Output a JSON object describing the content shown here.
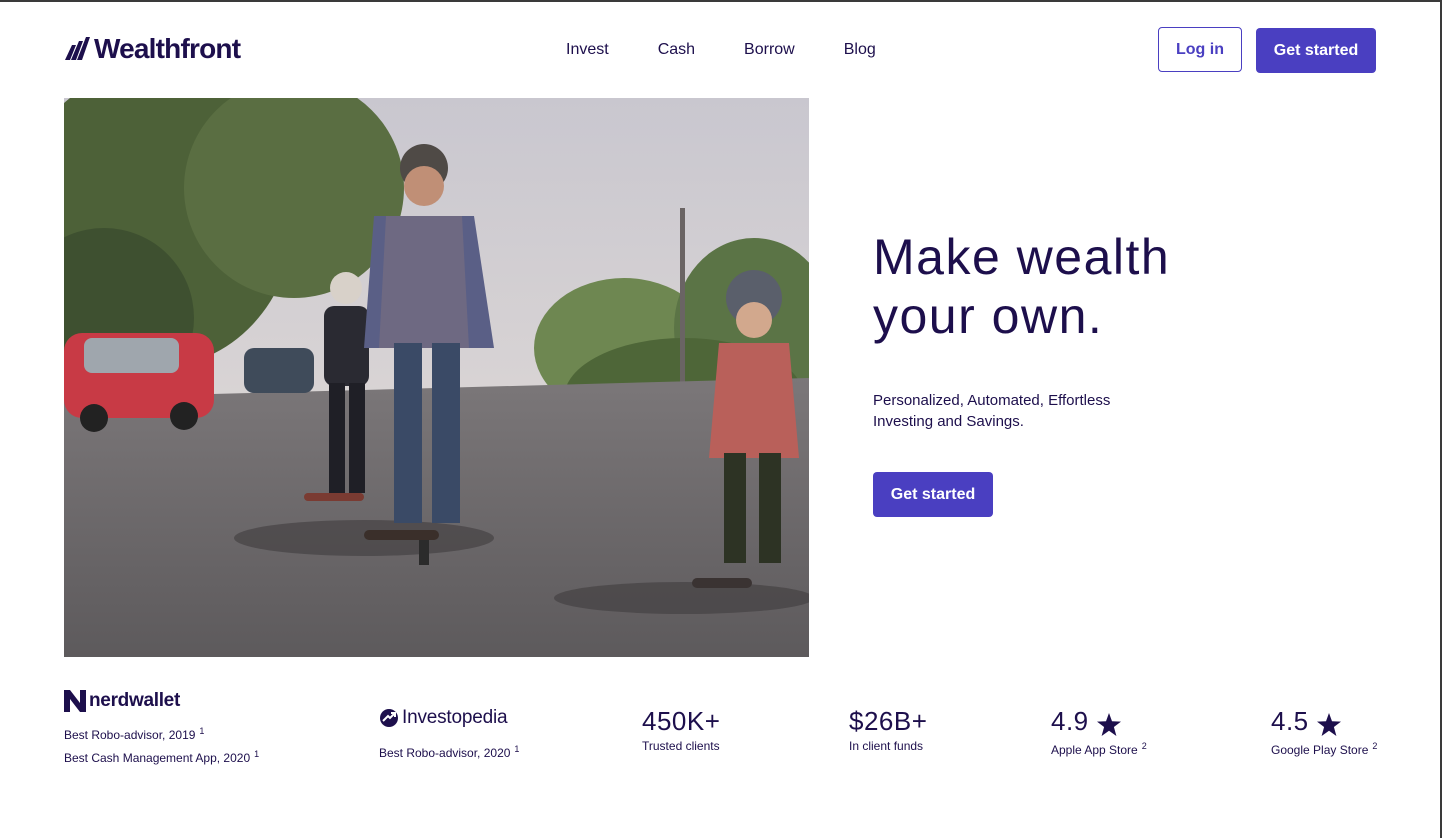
{
  "header": {
    "brand": "Wealthfront",
    "nav": [
      "Invest",
      "Cash",
      "Borrow",
      "Blog"
    ],
    "login_label": "Log in",
    "get_started_label": "Get started"
  },
  "hero": {
    "title_line1": "Make wealth",
    "title_line2": "your own.",
    "subtitle_line1": "Personalized, Automated, Effortless",
    "subtitle_line2": "Investing and Savings.",
    "cta_label": "Get started"
  },
  "awards": {
    "nerdwallet": {
      "logo_text": "nerdwallet",
      "line1": "Best Robo-advisor, 2019",
      "line1_fn": "1",
      "line2": "Best Cash Management App, 2020",
      "line2_fn": "1"
    },
    "investopedia": {
      "logo_text": "Investopedia",
      "line1": "Best Robo-advisor, 2020",
      "line1_fn": "1"
    }
  },
  "stats": [
    {
      "value": "450K+",
      "label": "Trusted clients"
    },
    {
      "value": "$26B+",
      "label": "In client funds"
    },
    {
      "value": "4.9",
      "label": "Apple App Store",
      "fn": "2",
      "icon": "star-icon"
    },
    {
      "value": "4.5",
      "label": "Google Play Store",
      "fn": "2",
      "icon": "star-icon"
    }
  ],
  "colors": {
    "brand_dark": "#1d0f4c",
    "accent": "#4a3fc1",
    "background": "#ffffff"
  }
}
